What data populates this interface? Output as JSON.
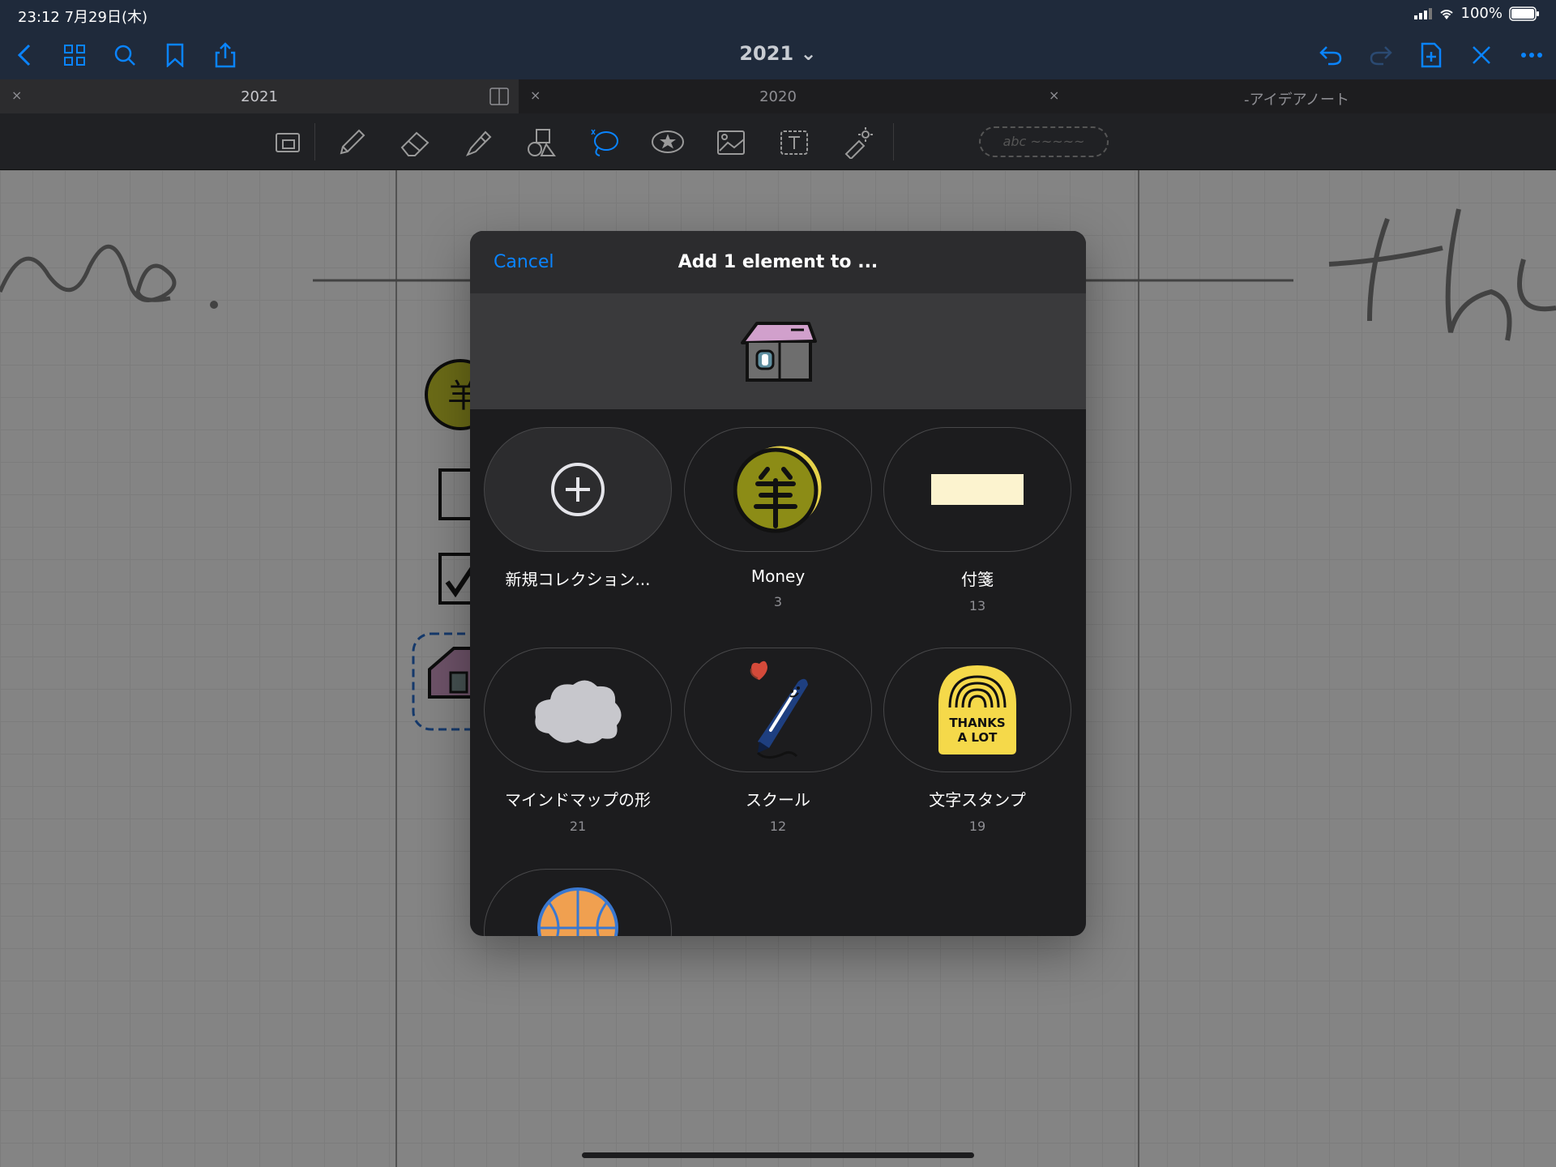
{
  "status_bar": {
    "time_date": "23:12   7月29日(木)",
    "battery": "100%"
  },
  "nav": {
    "title": "2021 ⌄"
  },
  "tabs": [
    {
      "label": "2021",
      "close": "×"
    },
    {
      "label": "2020",
      "close": "×"
    },
    {
      "label": "-アイデアノート",
      "close": "×"
    }
  ],
  "toolbar": {
    "abc_pill": "abc ~~~~~"
  },
  "modal": {
    "cancel": "Cancel",
    "title": "Add 1 element to ...",
    "collections": [
      {
        "name": "新規コレクション...",
        "count": ""
      },
      {
        "name": "Money",
        "count": "3"
      },
      {
        "name": "付箋",
        "count": "13"
      },
      {
        "name": "マインドマップの形",
        "count": "21"
      },
      {
        "name": "スクール",
        "count": "12"
      },
      {
        "name": "文字スタンプ",
        "count": "19"
      }
    ],
    "stamp_text": [
      "THANKS",
      "A LOT"
    ]
  },
  "colors": {
    "accent": "#0a84ff",
    "nav_bg": "#1f2a3b",
    "modal_bg": "#1c1c1e"
  }
}
